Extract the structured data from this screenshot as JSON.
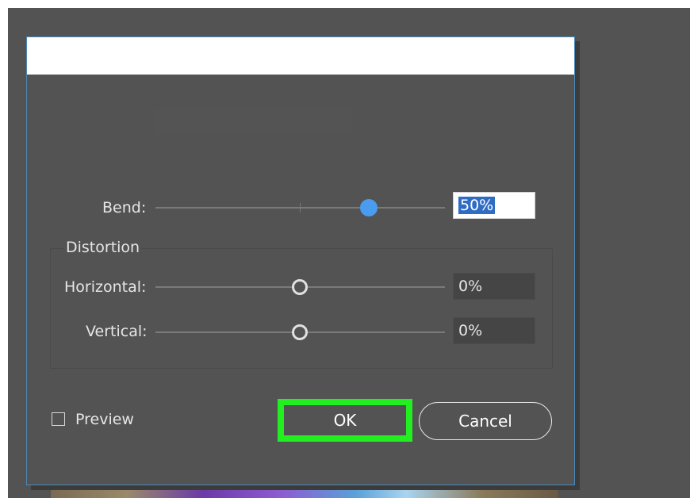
{
  "dialog": {
    "bend": {
      "label": "Bend:",
      "value": "50%",
      "level": 0.73
    },
    "distortion": {
      "group_label": "Distortion",
      "horizontal": {
        "label": "Horizontal:",
        "value": "0%",
        "level": 0.5
      },
      "vertical": {
        "label": "Vertical:",
        "value": "0%",
        "level": 0.5
      }
    },
    "preview": {
      "label": "Preview",
      "checked": false
    },
    "buttons": {
      "ok": "OK",
      "cancel": "Cancel"
    }
  },
  "colors": {
    "canvas_bg": "#535353",
    "dialog_bg": "#535353",
    "slider_knob_active": "#4a9cf0",
    "selection_highlight": "#2f6cc4",
    "ok_highlight_frame": "#22ee22"
  },
  "icons": {
    "checkbox": "checkbox-unchecked-icon"
  }
}
